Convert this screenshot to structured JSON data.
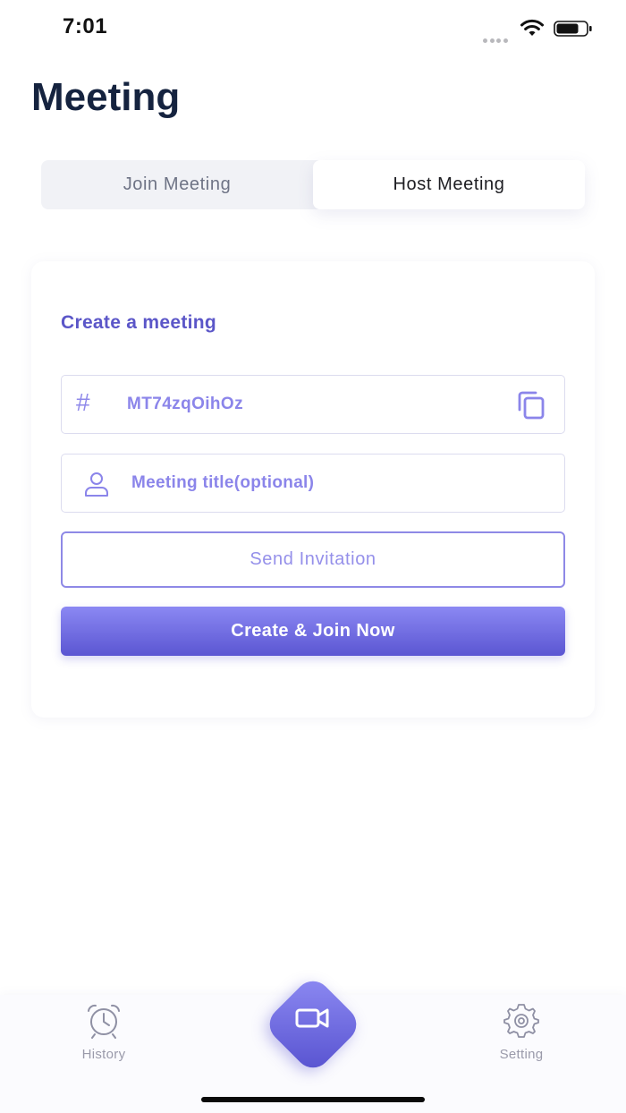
{
  "status_bar": {
    "time": "7:01",
    "icons": [
      "signal-dots",
      "wifi-icon",
      "battery-icon"
    ]
  },
  "page": {
    "title": "Meeting"
  },
  "tabs": [
    {
      "label": "Join Meeting",
      "selected": false
    },
    {
      "label": "Host Meeting",
      "selected": true
    }
  ],
  "card": {
    "heading": "Create a meeting",
    "meeting_id": {
      "prefix_icon": "hash-icon",
      "value": "MT74zqOihOz",
      "action_icon": "copy-icon"
    },
    "title_field": {
      "icon": "user-icon",
      "placeholder": "Meeting title(optional)",
      "value": ""
    },
    "send_invitation_label": "Send Invitation",
    "create_join_label": "Create & Join Now"
  },
  "tab_bar": {
    "items": [
      {
        "label": "History",
        "icon": "alarm-clock-icon"
      },
      {
        "label": "",
        "icon": "video-camera-icon"
      },
      {
        "label": "Setting",
        "icon": "gear-icon"
      }
    ]
  },
  "colors": {
    "accent": "#5b56c8",
    "accent_light": "#8b85ea",
    "title": "#15233f",
    "gradient_top": "#8b88f3",
    "gradient_bottom": "#5b56d2"
  }
}
